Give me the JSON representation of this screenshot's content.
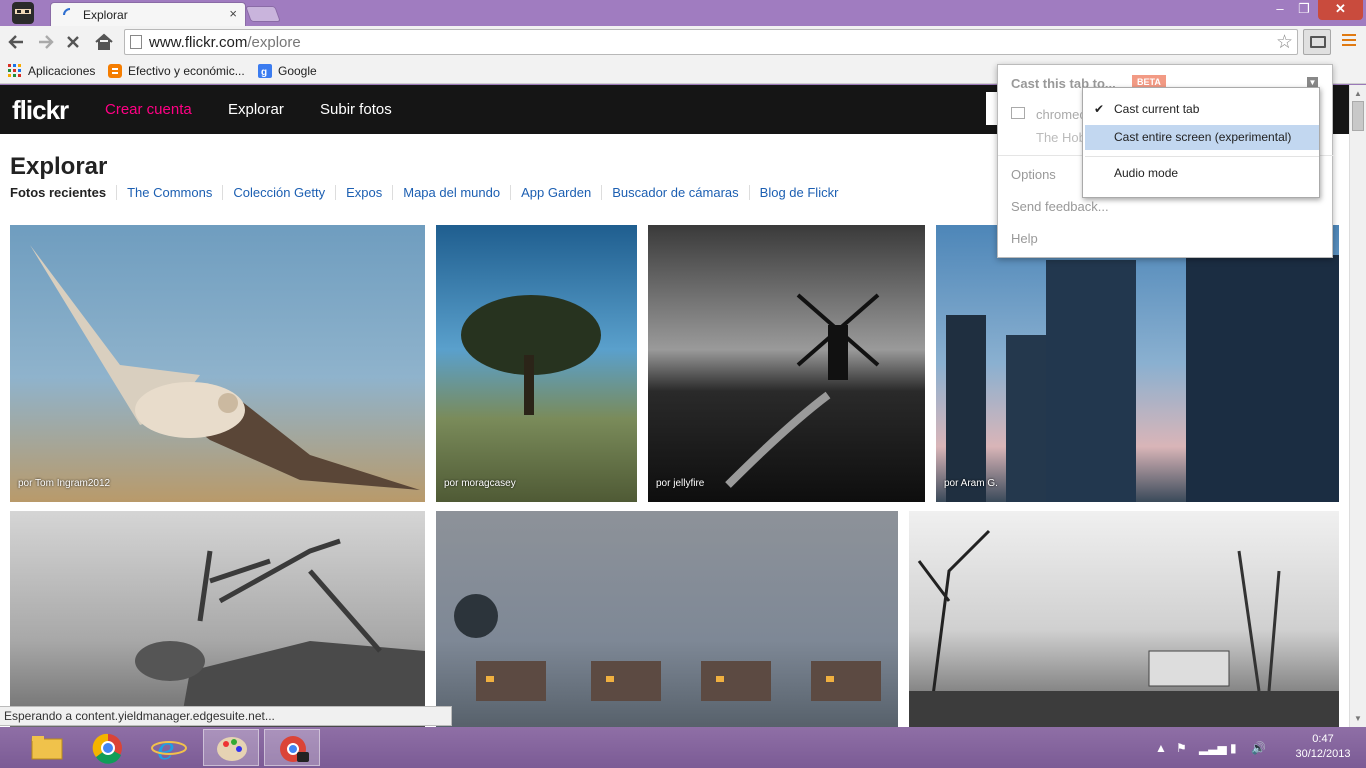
{
  "browser": {
    "tab_title": "Explorar",
    "tab_close": "×",
    "window_controls": {
      "minimize": "‒",
      "maximize": "❐",
      "close": "✕"
    },
    "url_host": "www.flickr.com",
    "url_path": "/explore",
    "bookmarks": [
      {
        "label": "Aplicaciones",
        "icon": "apps-grid-icon"
      },
      {
        "label": "Efectivo y económic...",
        "icon": "blogger-icon"
      },
      {
        "label": "Google",
        "icon": "google-icon"
      }
    ],
    "status_text": "Esperando a content.yieldmanager.edgesuite.net..."
  },
  "flickr": {
    "logo": "flickr",
    "nav": {
      "signup": "Crear cuenta",
      "explore": "Explorar",
      "upload": "Subir fotos"
    },
    "page_title": "Explorar",
    "subnav": [
      "Fotos recientes",
      "The Commons",
      "Colección Getty",
      "Expos",
      "Mapa del mundo",
      "App Garden",
      "Buscador de cámaras",
      "Blog de Flickr"
    ],
    "photos": [
      {
        "caption": "por Tom Ingram2012"
      },
      {
        "caption": "por moragcasey"
      },
      {
        "caption": "por jellyfire"
      },
      {
        "caption": "por Aram G."
      },
      {
        "caption": ""
      },
      {
        "caption": ""
      },
      {
        "caption": ""
      }
    ]
  },
  "cast": {
    "header": "Cast this tab to...",
    "beta": "BETA",
    "device_name": "chromec",
    "device_sub": "The Hob",
    "options": "Options",
    "feedback": "Send feedback...",
    "help": "Help",
    "menu": {
      "current_tab": "Cast current tab",
      "entire_screen": "Cast entire screen (experimental)",
      "audio_mode": "Audio mode",
      "check": "✔"
    }
  },
  "taskbar": {
    "time": "0:47",
    "date": "30/12/2013"
  },
  "colors": {
    "flickr_pink": "#ff0084",
    "link_blue": "#1c5fb2",
    "menu_highlight": "#c2d7f0",
    "beta_badge": "#f29a84",
    "window_frame": "#a07cc0"
  }
}
